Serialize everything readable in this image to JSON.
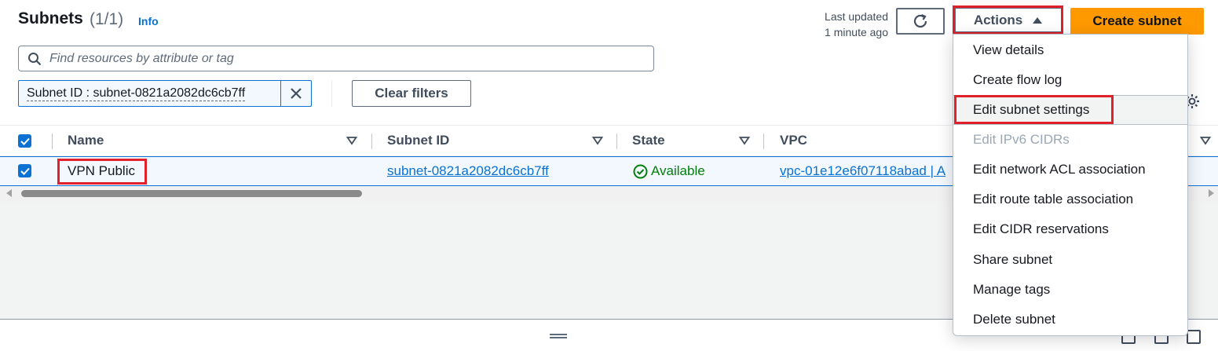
{
  "header": {
    "title": "Subnets",
    "count": "(1/1)",
    "info": "Info",
    "last_updated_line1": "Last updated",
    "last_updated_line2": "1 minute ago",
    "actions_label": "Actions",
    "create_label": "Create subnet"
  },
  "search": {
    "placeholder": "Find resources by attribute or tag"
  },
  "filters": {
    "token_label": "Subnet ID : subnet-0821a2082dc6cb7ff",
    "clear_label": "Clear filters"
  },
  "table": {
    "columns": [
      "Name",
      "Subnet ID",
      "State",
      "VPC"
    ],
    "rows": [
      {
        "selected": true,
        "name": "VPN Public",
        "subnet_id": "subnet-0821a2082dc6cb7ff",
        "state": "Available",
        "vpc": "vpc-01e12e6f07118abad | A"
      }
    ]
  },
  "actions_menu": {
    "items": [
      {
        "label": "View details",
        "disabled": false
      },
      {
        "label": "Create flow log",
        "disabled": false
      },
      {
        "label": "Edit subnet settings",
        "disabled": false,
        "highlighted": true
      },
      {
        "label": "Edit IPv6 CIDRs",
        "disabled": true
      },
      {
        "label": "Edit network ACL association",
        "disabled": false
      },
      {
        "label": "Edit route table association",
        "disabled": false
      },
      {
        "label": "Edit CIDR reservations",
        "disabled": false
      },
      {
        "label": "Share subnet",
        "disabled": false
      },
      {
        "label": "Manage tags",
        "disabled": false
      },
      {
        "label": "Delete subnet",
        "disabled": false
      }
    ]
  },
  "colors": {
    "accent": "#0972d3",
    "primary_button": "#ff9900",
    "success": "#037f0c",
    "annotation": "#e0212b"
  }
}
